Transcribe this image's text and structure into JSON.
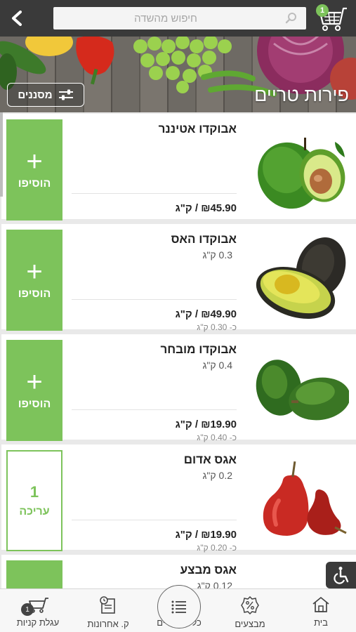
{
  "header": {
    "search_placeholder": "חיפוש מהשדה",
    "cart_count": "1"
  },
  "banner": {
    "title": "פירות טריים",
    "filter_label": "מסננים"
  },
  "products": [
    {
      "name": "אבוקדו אטיננר",
      "unit": "",
      "price": "₪45.90 / ק\"ג",
      "per_unit": "",
      "button": "הוסיפו"
    },
    {
      "name": "אבוקדו האס",
      "unit": "0.3 ק\"ג",
      "price": "₪49.90 / ק\"ג",
      "per_unit": "כ- 0.30 ק\"ג",
      "button": "הוסיפו"
    },
    {
      "name": "אבוקדו מובחר",
      "unit": "0.4 ק\"ג",
      "price": "₪19.90 / ק\"ג",
      "per_unit": "כ- 0.40 ק\"ג",
      "button": "הוסיפו"
    },
    {
      "name": "אגס אדום",
      "unit": "0.2 ק\"ג",
      "price": "₪19.90 / ק\"ג",
      "per_unit": "כ- 0.20 ק\"ג",
      "button": "עריכה",
      "qty": "1"
    },
    {
      "name": "אגס מבצע",
      "unit": "0.12 ק\"ג",
      "price": "",
      "per_unit": "",
      "button": ""
    }
  ],
  "bottom_nav": {
    "home": "בית",
    "deals": "מבצעים",
    "all_products": "כל המוצרים",
    "recent": "ק. אחרונות",
    "cart": "עגלת קניות",
    "cart_badge": "1"
  },
  "colors": {
    "accent_green": "#7dc35b",
    "topbar": "#3a3a3a"
  }
}
